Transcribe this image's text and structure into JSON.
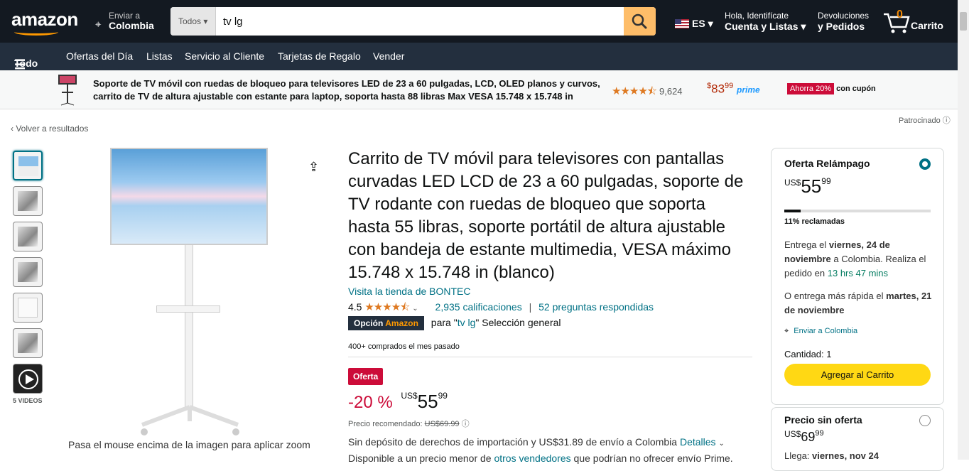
{
  "header": {
    "logo": "amazon",
    "deliver_line1": "Enviar a",
    "deliver_line2": "Colombia",
    "search_category": "Todos",
    "search_value": "tv lg",
    "lang": "ES",
    "account_line1": "Hola, Identifícate",
    "account_line2": "Cuenta y Listas",
    "returns_line1": "Devoluciones",
    "returns_line2": "y Pedidos",
    "cart_count": "0",
    "cart_label": "Carrito"
  },
  "nav": {
    "all": "Todo",
    "items": [
      "Ofertas del Día",
      "Listas",
      "Servicio al Cliente",
      "Tarjetas de Regalo",
      "Vender"
    ]
  },
  "promo": {
    "text": "Soporte de TV móvil con ruedas de bloqueo para televisores LED de 23 a 60 pulgadas, LCD, OLED planos y curvos, carrito de TV de altura ajustable con estante para laptop, soporta hasta 88 libras Max VESA 15.748 x 15.748 in",
    "rating_count": "9,624",
    "price_whole": "83",
    "price_frac": "99",
    "prime": "prime",
    "coupon_badge": "Ahorra 20%",
    "coupon_text": "con cupón",
    "rating_value": 4.5
  },
  "sponsored": "Patrocinado",
  "back": "Volver a resultados",
  "videos_label": "5 VIDEOS",
  "zoom_hint": "Pasa el mouse encima de la imagen para aplicar zoom",
  "product": {
    "title": "Carrito de TV móvil para televisores con pantallas curvadas LED LCD de 23 a 60 pulgadas, soporte de TV rodante con ruedas de bloqueo que soporta hasta 55 libras, soporte portátil de altura ajustable con bandeja de estante multimedia, VESA máximo 15.748 x 15.748 in (blanco)",
    "store": "Visita la tienda de BONTEC",
    "rating": "4.5",
    "ratings_count": "2,935 calificaciones",
    "questions": "52 preguntas respondidas",
    "choice_label": "Opción",
    "choice_brand": "Amazon",
    "choice_for": "para",
    "choice_query": "tv lg",
    "choice_rest": "Selección general",
    "bought": "400+ comprados el mes pasado",
    "deal_badge": "Oferta",
    "discount": "-20 %",
    "currency": "US$",
    "price_whole": "55",
    "price_frac": "99",
    "rec_label": "Precio recomendado:",
    "rec_price": "US$69.99",
    "shipping": "Sin depósito de derechos de importación y US$31.89 de envío a Colombia",
    "details": "Detalles",
    "avail": "Disponible a un precio menor de",
    "avail_link": "otros vendedores",
    "avail_rest": "que podrían no ofrecer envío Prime."
  },
  "buybox": {
    "title": "Oferta Relámpago",
    "currency": "US$",
    "price_whole": "55",
    "price_frac": "99",
    "claimed_pct": 11,
    "claimed": "11% reclamadas",
    "delivery_pre": "Entrega el",
    "delivery_date": "viernes, 24 de noviembre",
    "delivery_mid": "a Colombia. Realiza el pedido en",
    "delivery_time": "13 hrs 47 mins",
    "fast_pre": "O entrega más rápida el",
    "fast_date": "martes, 21 de noviembre",
    "ship_to": "Enviar a Colombia",
    "quantity": "Cantidad: 1",
    "add_to_cart": "Agregar al Carrito"
  },
  "buybox2": {
    "title": "Precio sin oferta",
    "currency": "US$",
    "price_whole": "69",
    "price_frac": "99",
    "arrives_pre": "Llega:",
    "arrives": "viernes, nov 24"
  }
}
